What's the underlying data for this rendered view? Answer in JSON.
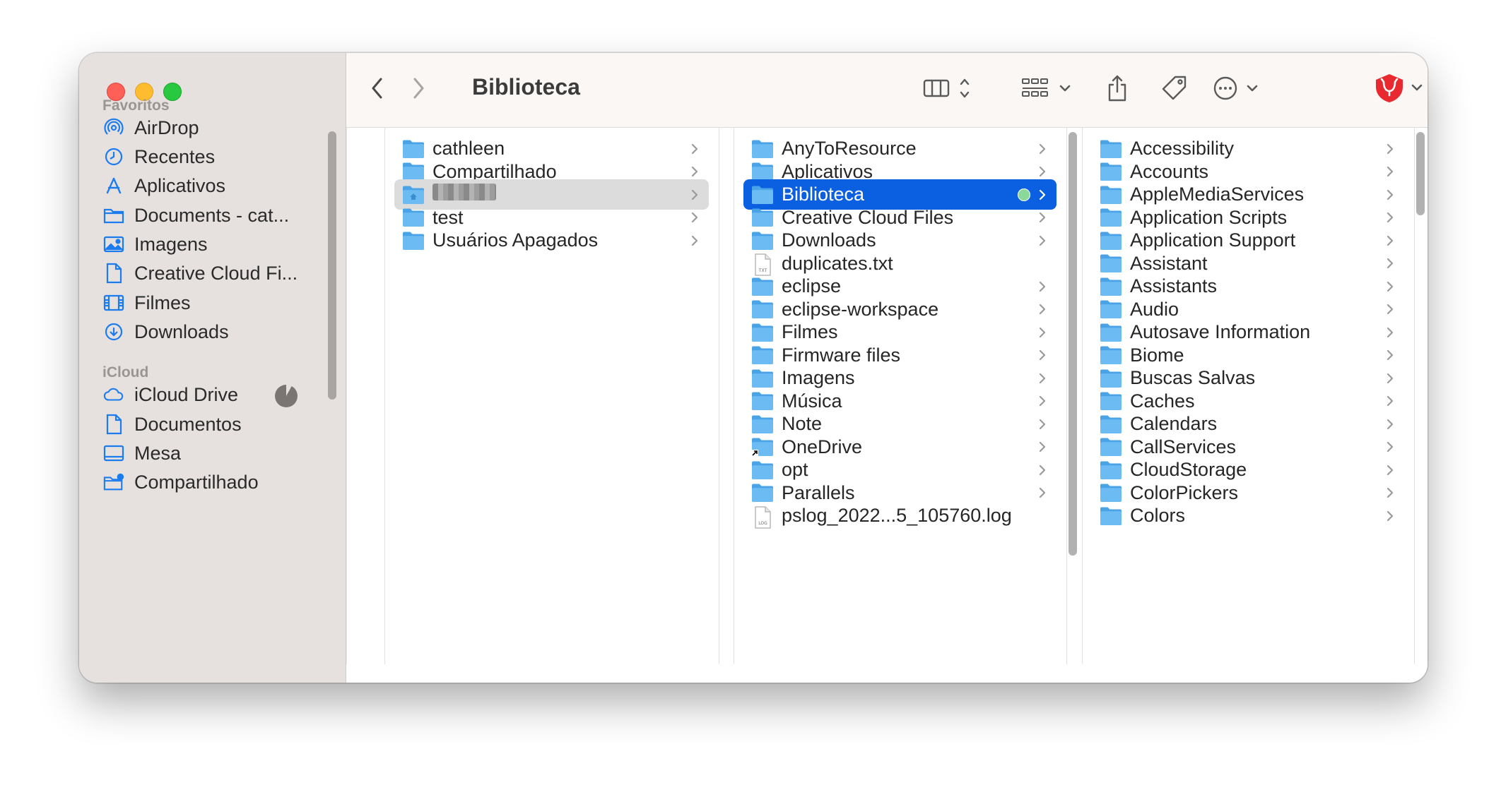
{
  "window": {
    "title": "Biblioteca"
  },
  "colors": {
    "accent": "#0a60e0",
    "folder": "#5ab1ee",
    "sidebar_icon": "#1b7cf0",
    "tag_green": "#8ad99b",
    "shield_red": "#e8292f"
  },
  "toolbar": {
    "back": "chevron-left-icon",
    "forward": "chevron-right-icon",
    "view": "column-view-icon",
    "group": "grid-group-icon",
    "share": "share-icon",
    "tag": "tag-icon",
    "more": "ellipsis-circle-icon",
    "extension": "shield-extension-icon",
    "search": "search-icon"
  },
  "sidebar": {
    "favorites_heading": "Favoritos",
    "favorites": [
      {
        "label": "AirDrop",
        "icon": "airdrop-icon"
      },
      {
        "label": "Recentes",
        "icon": "clock-icon"
      },
      {
        "label": "Aplicativos",
        "icon": "apps-icon"
      },
      {
        "label": "Documents - cat...",
        "icon": "folder-icon"
      },
      {
        "label": "Imagens",
        "icon": "photo-icon"
      },
      {
        "label": "Creative Cloud Fi...",
        "icon": "document-icon"
      },
      {
        "label": "Filmes",
        "icon": "film-icon"
      },
      {
        "label": "Downloads",
        "icon": "download-icon"
      }
    ],
    "icloud_heading": "iCloud",
    "icloud": [
      {
        "label": "iCloud Drive",
        "icon": "cloud-icon"
      },
      {
        "label": "Documentos",
        "icon": "document-icon"
      },
      {
        "label": "Mesa",
        "icon": "desktop-icon"
      },
      {
        "label": "Compartilhado",
        "icon": "shared-folder-icon"
      }
    ]
  },
  "columns": [
    {
      "items": [
        {
          "name": "cathleen",
          "kind": "folder",
          "chevron": true
        },
        {
          "name": "Compartilhado",
          "kind": "folder",
          "chevron": true
        },
        {
          "name": "",
          "kind": "home-folder",
          "chevron": true,
          "selected": "inactive",
          "redacted": true
        },
        {
          "name": "test",
          "kind": "folder",
          "chevron": true
        },
        {
          "name": "Usuários Apagados",
          "kind": "folder",
          "chevron": true
        }
      ]
    },
    {
      "items": [
        {
          "name": "AnyToResource",
          "kind": "folder",
          "chevron": true
        },
        {
          "name": "Aplicativos",
          "kind": "folder",
          "chevron": true
        },
        {
          "name": "Biblioteca",
          "kind": "folder",
          "chevron": true,
          "selected": "active",
          "tag": true
        },
        {
          "name": "Creative Cloud Files",
          "kind": "folder",
          "chevron": true
        },
        {
          "name": "Downloads",
          "kind": "folder",
          "chevron": true
        },
        {
          "name": "duplicates.txt",
          "kind": "file-txt",
          "chevron": false
        },
        {
          "name": "eclipse",
          "kind": "folder",
          "chevron": true
        },
        {
          "name": "eclipse-workspace",
          "kind": "folder",
          "chevron": true
        },
        {
          "name": "Filmes",
          "kind": "folder",
          "chevron": true
        },
        {
          "name": "Firmware files",
          "kind": "folder",
          "chevron": true
        },
        {
          "name": "Imagens",
          "kind": "folder",
          "chevron": true
        },
        {
          "name": "Música",
          "kind": "folder",
          "chevron": true
        },
        {
          "name": "Note",
          "kind": "folder",
          "chevron": true
        },
        {
          "name": "OneDrive",
          "kind": "folder-alias",
          "chevron": true
        },
        {
          "name": "opt",
          "kind": "folder",
          "chevron": true
        },
        {
          "name": "Parallels",
          "kind": "folder",
          "chevron": true
        },
        {
          "name": "pslog_2022...5_105760.log",
          "kind": "file-log",
          "chevron": false
        }
      ]
    },
    {
      "items": [
        {
          "name": "Accessibility",
          "kind": "folder",
          "chevron": true
        },
        {
          "name": "Accounts",
          "kind": "folder",
          "chevron": true
        },
        {
          "name": "AppleMediaServices",
          "kind": "folder",
          "chevron": true
        },
        {
          "name": "Application Scripts",
          "kind": "folder",
          "chevron": true
        },
        {
          "name": "Application Support",
          "kind": "folder",
          "chevron": true
        },
        {
          "name": "Assistant",
          "kind": "folder",
          "chevron": true
        },
        {
          "name": "Assistants",
          "kind": "folder",
          "chevron": true
        },
        {
          "name": "Audio",
          "kind": "folder",
          "chevron": true
        },
        {
          "name": "Autosave Information",
          "kind": "folder",
          "chevron": true
        },
        {
          "name": "Biome",
          "kind": "folder",
          "chevron": true
        },
        {
          "name": "Buscas Salvas",
          "kind": "folder",
          "chevron": true
        },
        {
          "name": "Caches",
          "kind": "folder",
          "chevron": true
        },
        {
          "name": "Calendars",
          "kind": "folder",
          "chevron": true
        },
        {
          "name": "CallServices",
          "kind": "folder",
          "chevron": true
        },
        {
          "name": "CloudStorage",
          "kind": "folder",
          "chevron": true
        },
        {
          "name": "ColorPickers",
          "kind": "folder",
          "chevron": true
        },
        {
          "name": "Colors",
          "kind": "folder",
          "chevron": true
        }
      ]
    }
  ]
}
